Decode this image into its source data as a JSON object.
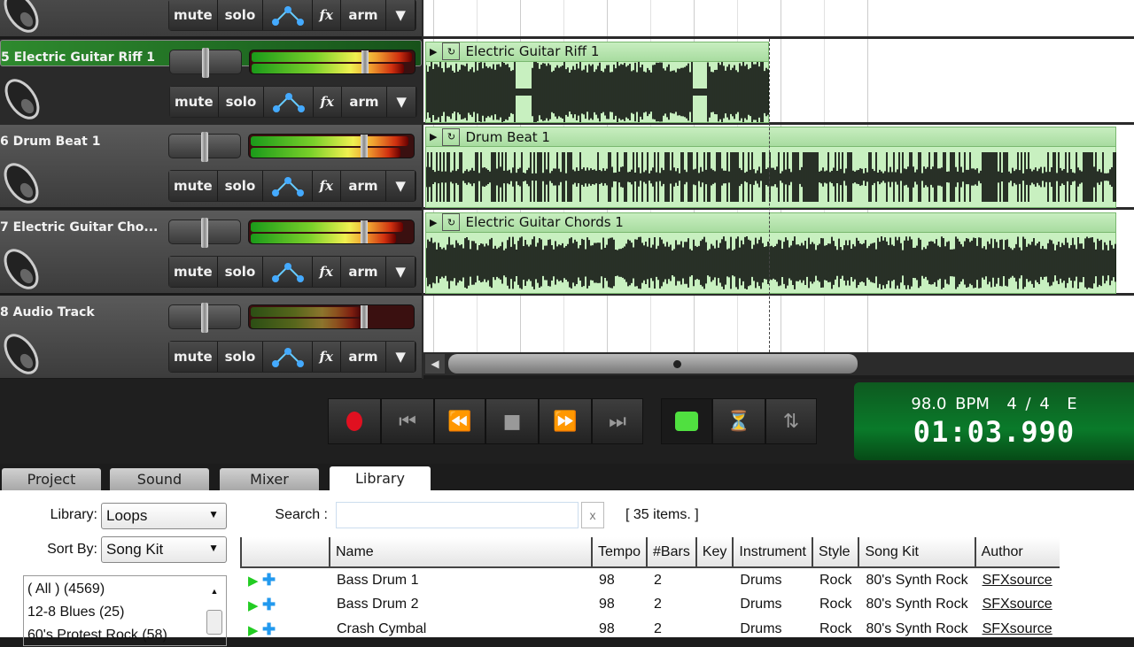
{
  "tracks": [
    {
      "name": "",
      "selected": false
    },
    {
      "name": "5 Electric Guitar Riff 1",
      "selected": true,
      "clip": "Electric Guitar Riff 1"
    },
    {
      "name": "6 Drum Beat 1",
      "selected": false,
      "clip": "Drum Beat 1"
    },
    {
      "name": "7 Electric Guitar Cho...",
      "selected": false,
      "clip": "Electric Guitar Chords 1"
    },
    {
      "name": "8 Audio Track",
      "selected": false
    }
  ],
  "track_buttons": {
    "mute": "mute",
    "solo": "solo",
    "fx": "fx",
    "arm": "arm"
  },
  "meter_levels": [
    0.7,
    0.95,
    0.9,
    0.8,
    0
  ],
  "transport": {
    "bpm": "98.0 BPM",
    "time_signature": "4 / 4",
    "key": "E",
    "time": "01:03.990",
    "record_color": "#e01020",
    "loop_color": "#50e040"
  },
  "tabs": [
    "Project",
    "Sound",
    "Mixer",
    "Library"
  ],
  "active_tab": "Library",
  "library": {
    "library_label": "Library:",
    "library_value": "Loops",
    "sort_label": "Sort By:",
    "sort_value": "Song Kit",
    "search_label": "Search :",
    "search_value": "",
    "clear": "x",
    "count": "[ 35 items. ]",
    "categories": [
      "( All )  (4569)",
      "12-8 Blues  (25)",
      "60's Protest Rock  (58)"
    ],
    "columns": [
      "",
      "Name",
      "Tempo",
      "#Bars",
      "Key",
      "Instrument",
      "Style",
      "Song Kit",
      "Author"
    ],
    "rows": [
      [
        "Bass Drum 1",
        "98",
        "2",
        "",
        "Drums",
        "Rock",
        "80's Synth Rock",
        "SFXsource"
      ],
      [
        "Bass Drum 2",
        "98",
        "2",
        "",
        "Drums",
        "Rock",
        "80's Synth Rock",
        "SFXsource"
      ],
      [
        "Crash Cymbal",
        "98",
        "2",
        "",
        "Drums",
        "Rock",
        "80's Synth Rock",
        "SFXsource"
      ]
    ]
  }
}
